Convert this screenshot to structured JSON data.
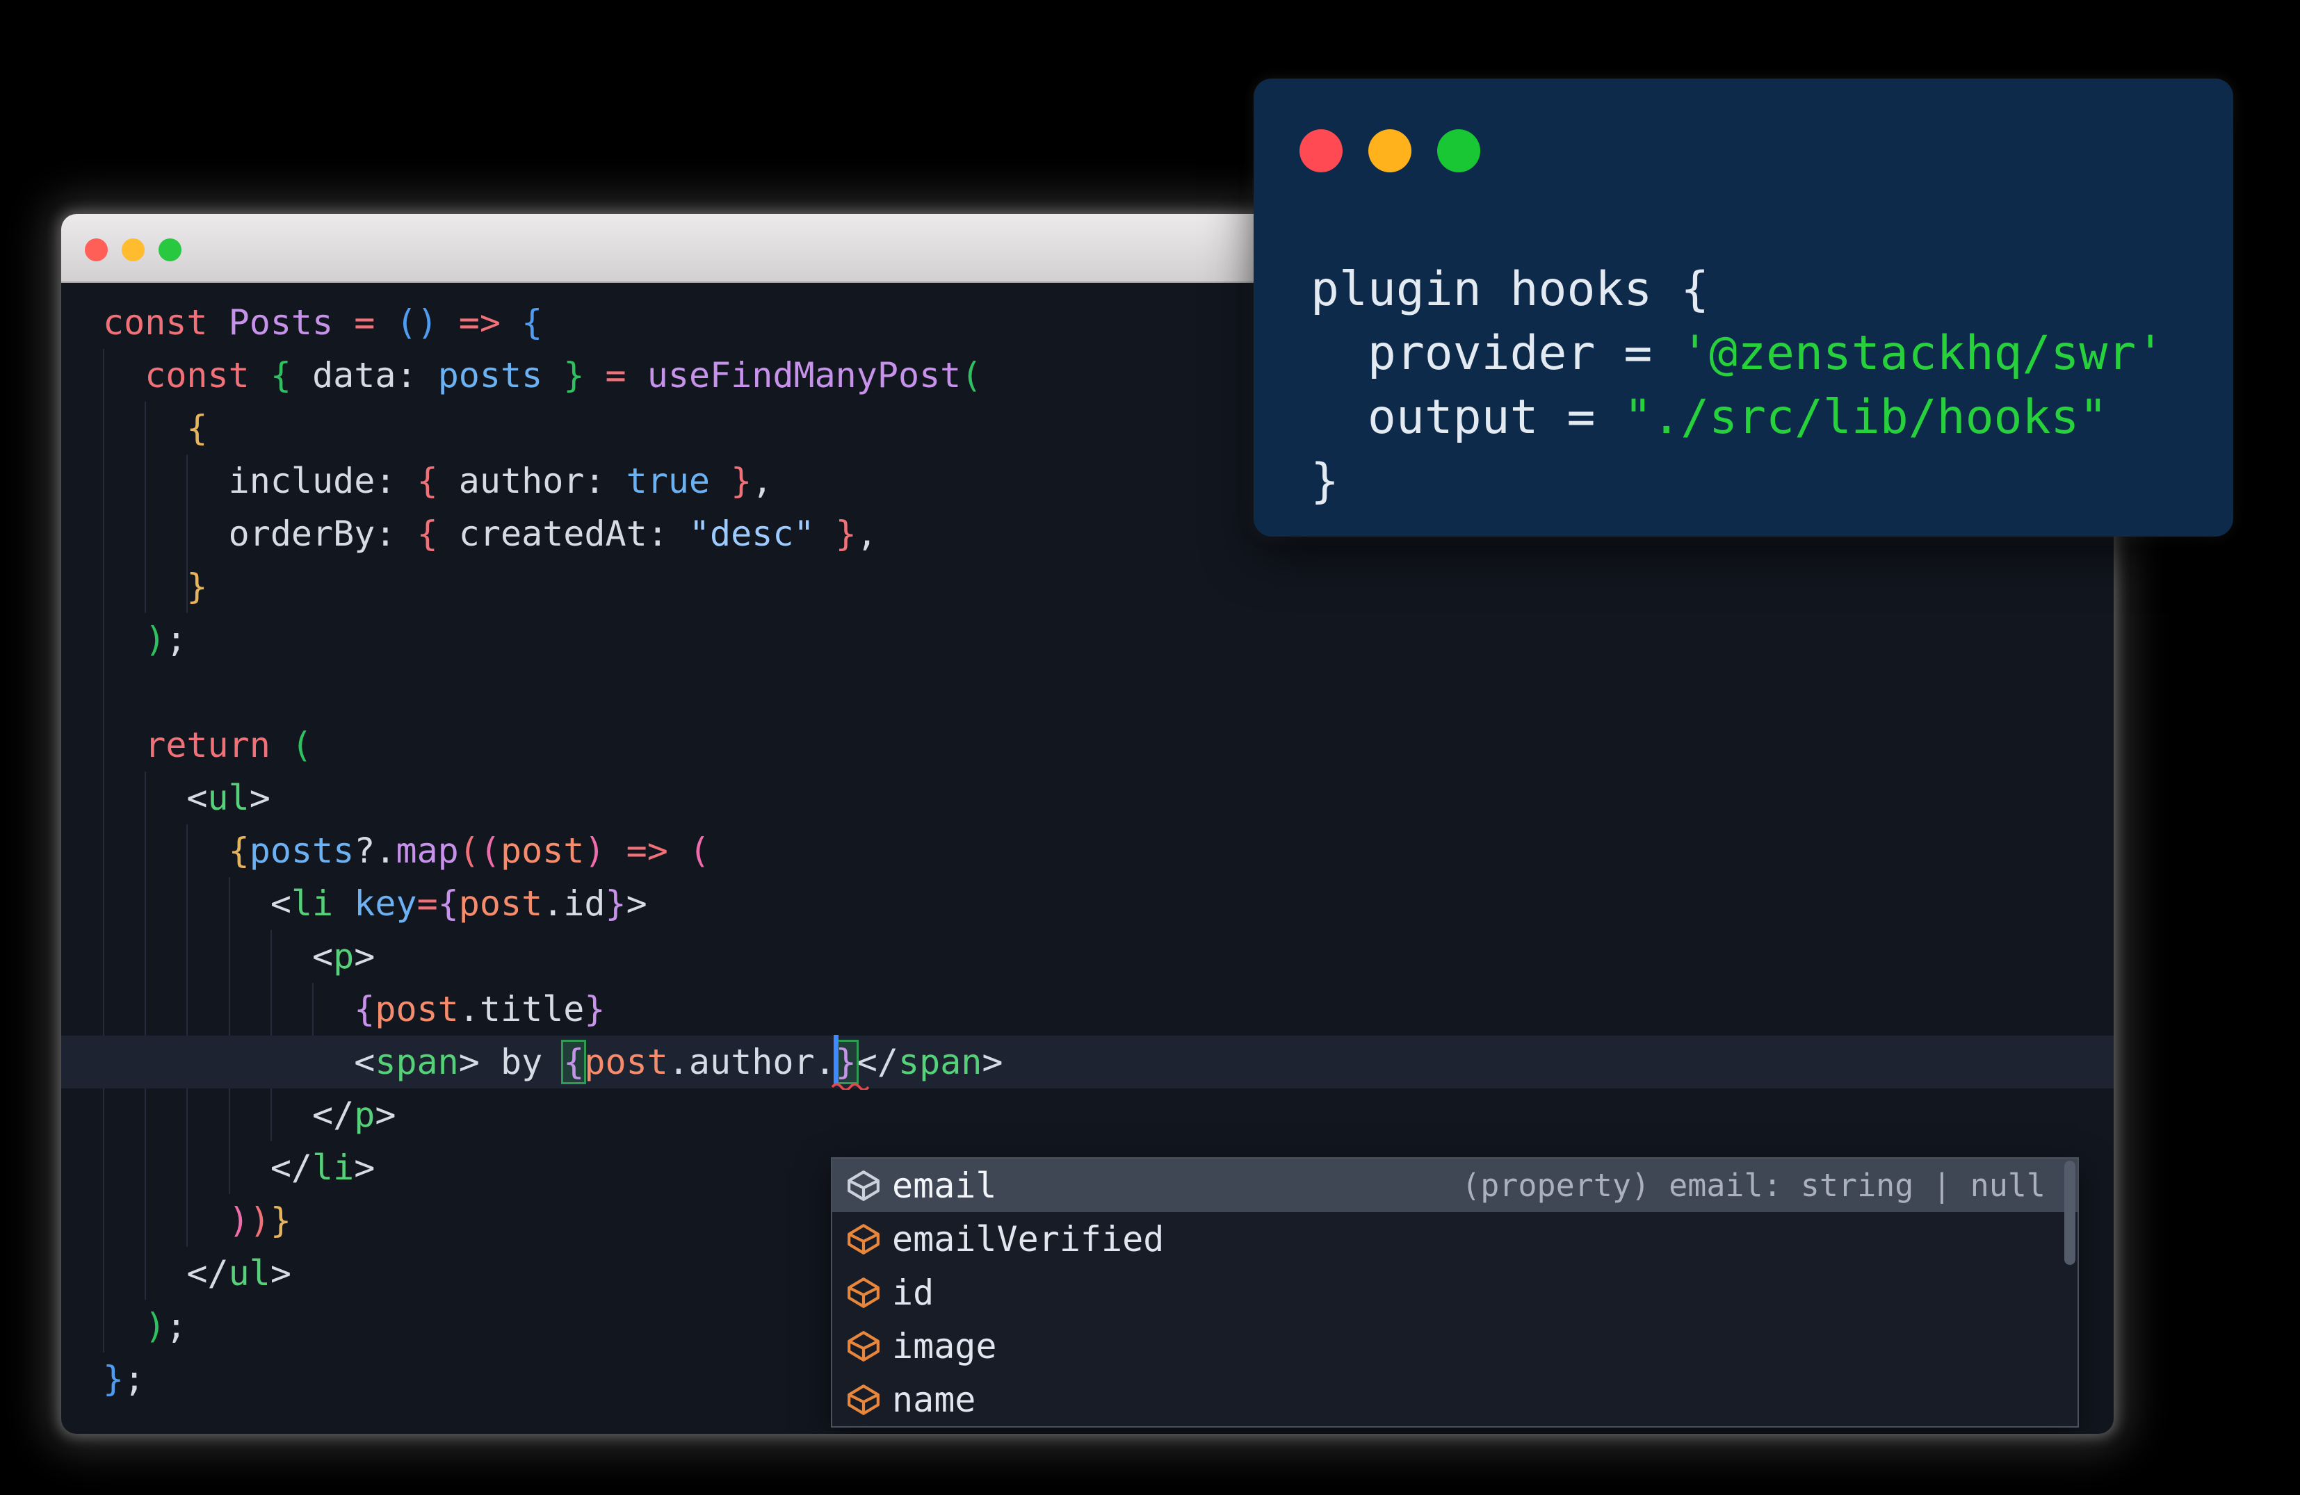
{
  "background_color": "#000000",
  "main_window": {
    "traffic_lights": {
      "close": "#ff5f57",
      "minimize": "#febc2e",
      "zoom": "#28c840"
    },
    "editor": {
      "background": "#12161f",
      "current_line_background": "#1d2330",
      "cursor_color": "#3e8bff",
      "bracket_match_color": "#2e9a52",
      "error_squiggle_color": "#e5484d",
      "palette": {
        "fg": "#d6dce6",
        "kw": "#f07178",
        "purple": "#c792ea",
        "blue": "#6cb2f2",
        "str": "#9ecbff",
        "orange": "#f78c6c",
        "tag": "#56d17a",
        "b1": "#509cf0",
        "b2": "#2fc05f",
        "b3": "#e6b45c",
        "b4": "#f07178",
        "b5": "#ee6cab",
        "b6": "#c792ea"
      },
      "lines": [
        {
          "tokens": [
            {
              "t": "const ",
              "c": "kw"
            },
            {
              "t": "Posts ",
              "c": "purple"
            },
            {
              "t": "= ",
              "c": "kw"
            },
            {
              "t": "()",
              "c": "b1"
            },
            {
              "t": " "
            },
            {
              "t": "=> ",
              "c": "kw"
            },
            {
              "t": "{",
              "c": "b1"
            }
          ]
        },
        {
          "tokens": [
            {
              "t": "  "
            },
            {
              "t": "const ",
              "c": "kw"
            },
            {
              "t": "{ ",
              "c": "b2"
            },
            {
              "t": "data: ",
              "c": "fg"
            },
            {
              "t": "posts ",
              "c": "blue"
            },
            {
              "t": "} ",
              "c": "b2"
            },
            {
              "t": "= ",
              "c": "kw"
            },
            {
              "t": "useFindManyPost",
              "c": "purple"
            },
            {
              "t": "(",
              "c": "b2"
            }
          ]
        },
        {
          "tokens": [
            {
              "t": "    "
            },
            {
              "t": "{",
              "c": "b3"
            }
          ]
        },
        {
          "tokens": [
            {
              "t": "      "
            },
            {
              "t": "include: ",
              "c": "fg"
            },
            {
              "t": "{ ",
              "c": "b4"
            },
            {
              "t": "author: ",
              "c": "fg"
            },
            {
              "t": "true",
              "c": "blue"
            },
            {
              "t": " }",
              "c": "b4"
            },
            {
              "t": ",",
              "c": "fg"
            }
          ]
        },
        {
          "tokens": [
            {
              "t": "      "
            },
            {
              "t": "orderBy: ",
              "c": "fg"
            },
            {
              "t": "{ ",
              "c": "b4"
            },
            {
              "t": "createdAt: ",
              "c": "fg"
            },
            {
              "t": "\"desc\"",
              "c": "str"
            },
            {
              "t": " }",
              "c": "b4"
            },
            {
              "t": ",",
              "c": "fg"
            }
          ]
        },
        {
          "tokens": [
            {
              "t": "    "
            },
            {
              "t": "}",
              "c": "b3"
            }
          ]
        },
        {
          "tokens": [
            {
              "t": "  "
            },
            {
              "t": ")",
              "c": "b2"
            },
            {
              "t": ";",
              "c": "fg"
            }
          ]
        },
        {
          "tokens": []
        },
        {
          "tokens": [
            {
              "t": "  "
            },
            {
              "t": "return ",
              "c": "kw"
            },
            {
              "t": "(",
              "c": "b2"
            }
          ]
        },
        {
          "tokens": [
            {
              "t": "    "
            },
            {
              "t": "<",
              "c": "fg"
            },
            {
              "t": "ul",
              "c": "tag"
            },
            {
              "t": ">",
              "c": "fg"
            }
          ]
        },
        {
          "tokens": [
            {
              "t": "      "
            },
            {
              "t": "{",
              "c": "b3"
            },
            {
              "t": "posts",
              "c": "blue"
            },
            {
              "t": "?.",
              "c": "fg"
            },
            {
              "t": "map",
              "c": "purple"
            },
            {
              "t": "(",
              "c": "b4"
            },
            {
              "t": "(",
              "c": "b5"
            },
            {
              "t": "post",
              "c": "orange"
            },
            {
              "t": ")",
              "c": "b5"
            },
            {
              "t": " "
            },
            {
              "t": "=> ",
              "c": "kw"
            },
            {
              "t": "(",
              "c": "b5"
            }
          ]
        },
        {
          "tokens": [
            {
              "t": "        "
            },
            {
              "t": "<",
              "c": "fg"
            },
            {
              "t": "li ",
              "c": "tag"
            },
            {
              "t": "key",
              "c": "blue"
            },
            {
              "t": "=",
              "c": "kw"
            },
            {
              "t": "{",
              "c": "b6"
            },
            {
              "t": "post",
              "c": "orange"
            },
            {
              "t": ".id",
              "c": "fg"
            },
            {
              "t": "}",
              "c": "b6"
            },
            {
              "t": ">",
              "c": "fg"
            }
          ]
        },
        {
          "tokens": [
            {
              "t": "          "
            },
            {
              "t": "<",
              "c": "fg"
            },
            {
              "t": "p",
              "c": "tag"
            },
            {
              "t": ">",
              "c": "fg"
            }
          ]
        },
        {
          "tokens": [
            {
              "t": "            "
            },
            {
              "t": "{",
              "c": "b6"
            },
            {
              "t": "post",
              "c": "orange"
            },
            {
              "t": ".title",
              "c": "fg"
            },
            {
              "t": "}",
              "c": "b6"
            }
          ]
        },
        {
          "highlighted": true,
          "tokens": [
            {
              "t": "            "
            },
            {
              "t": "<",
              "c": "fg"
            },
            {
              "t": "span",
              "c": "tag"
            },
            {
              "t": "> ",
              "c": "fg"
            },
            {
              "t": "by ",
              "c": "fg"
            },
            {
              "t": "{",
              "c": "b6",
              "m": true
            },
            {
              "t": "post",
              "c": "orange"
            },
            {
              "t": ".author.",
              "c": "fg"
            },
            {
              "cursor": true
            },
            {
              "t": "}",
              "c": "b6",
              "m": true
            },
            {
              "t": "</",
              "c": "fg"
            },
            {
              "t": "span",
              "c": "tag"
            },
            {
              "t": ">",
              "c": "fg"
            }
          ]
        },
        {
          "tokens": [
            {
              "t": "          "
            },
            {
              "t": "</",
              "c": "fg"
            },
            {
              "t": "p",
              "c": "tag"
            },
            {
              "t": ">",
              "c": "fg"
            }
          ]
        },
        {
          "tokens": [
            {
              "t": "        "
            },
            {
              "t": "</",
              "c": "fg"
            },
            {
              "t": "li",
              "c": "tag"
            },
            {
              "t": ">",
              "c": "fg"
            }
          ]
        },
        {
          "tokens": [
            {
              "t": "      "
            },
            {
              "t": ")",
              "c": "b5"
            },
            {
              "t": ")",
              "c": "b4"
            },
            {
              "t": "}",
              "c": "b3"
            }
          ]
        },
        {
          "tokens": [
            {
              "t": "    "
            },
            {
              "t": "</",
              "c": "fg"
            },
            {
              "t": "ul",
              "c": "tag"
            },
            {
              "t": ">",
              "c": "fg"
            }
          ]
        },
        {
          "tokens": [
            {
              "t": "  "
            },
            {
              "t": ")",
              "c": "b2"
            },
            {
              "t": ";",
              "c": "fg"
            }
          ]
        },
        {
          "tokens": [
            {
              "t": "}",
              "c": "b1"
            },
            {
              "t": ";",
              "c": "fg"
            }
          ]
        }
      ]
    },
    "suggest_widget": {
      "background": "#171c26",
      "selected_background": "#3f4654",
      "icon_color_selected": "#ccd2db",
      "icon_color_default": "#e8863c",
      "items": [
        {
          "label": "email",
          "selected": true,
          "detail": "(property) email: string | null"
        },
        {
          "label": "emailVerified",
          "selected": false,
          "detail": ""
        },
        {
          "label": "id",
          "selected": false,
          "detail": ""
        },
        {
          "label": "image",
          "selected": false,
          "detail": ""
        },
        {
          "label": "name",
          "selected": false,
          "detail": ""
        }
      ]
    }
  },
  "overlay_window": {
    "background": "#0d2a4a",
    "traffic_lights": {
      "close": "#ff4a54",
      "minimize": "#ffb21c",
      "zoom": "#19c734"
    },
    "palette": {
      "w": "#e3eaf2",
      "g": "#27d13c"
    },
    "lines": [
      [
        {
          "t": "plugin hooks {",
          "c": "w"
        }
      ],
      [
        {
          "t": "  provider = ",
          "c": "w"
        },
        {
          "t": "'@zenstackhq/swr'",
          "c": "g"
        }
      ],
      [
        {
          "t": "  output = ",
          "c": "w"
        },
        {
          "t": "\"./src/lib/hooks\"",
          "c": "g"
        }
      ],
      [
        {
          "t": "}",
          "c": "w"
        }
      ]
    ]
  }
}
